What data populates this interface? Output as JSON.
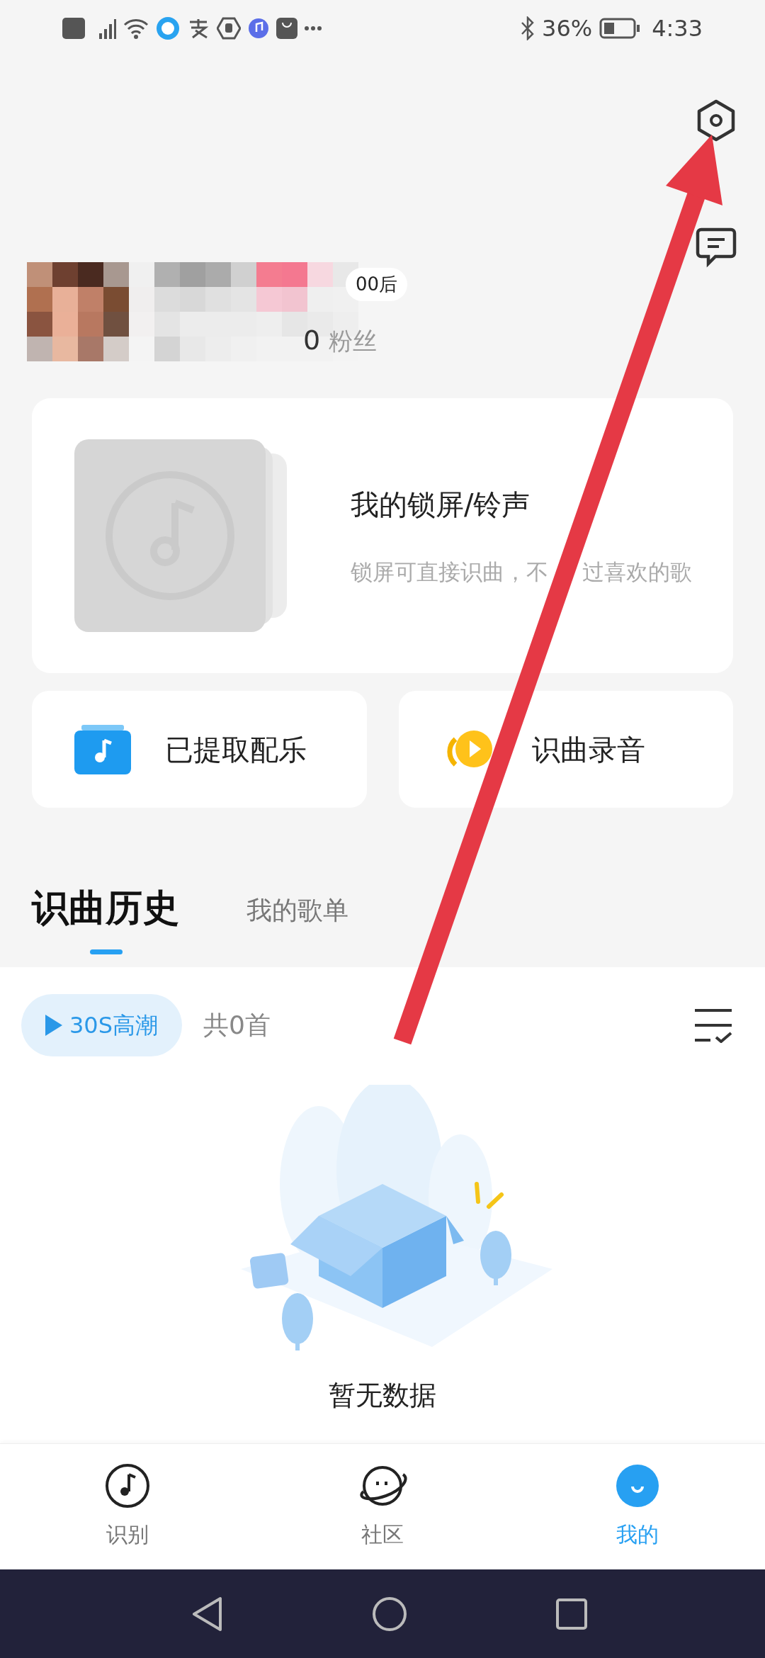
{
  "status_bar": {
    "battery": "36%",
    "time": "4:33"
  },
  "profile": {
    "tag": "00后",
    "followers_count": "0",
    "followers_label": "粉丝"
  },
  "lockscreen_card": {
    "title": "我的锁屏/铃声",
    "subtitle_parts": [
      "锁屏可直接识曲，不",
      "过喜欢的歌"
    ]
  },
  "shortcuts": [
    {
      "kind": "extracted",
      "label": "已提取配乐"
    },
    {
      "kind": "record",
      "label": "识曲录音"
    }
  ],
  "tabs": [
    {
      "label": "识曲历史",
      "selected": true
    },
    {
      "label": "我的歌单",
      "selected": false
    }
  ],
  "playlist_bar": {
    "play_button": "30S高潮",
    "count": "共0首"
  },
  "empty_state": {
    "message": "暂无数据"
  },
  "bottom_nav": [
    {
      "kind": "recognize",
      "label": "识别",
      "selected": false
    },
    {
      "kind": "community",
      "label": "社区",
      "selected": false
    },
    {
      "kind": "mine",
      "label": "我的",
      "selected": true
    }
  ]
}
